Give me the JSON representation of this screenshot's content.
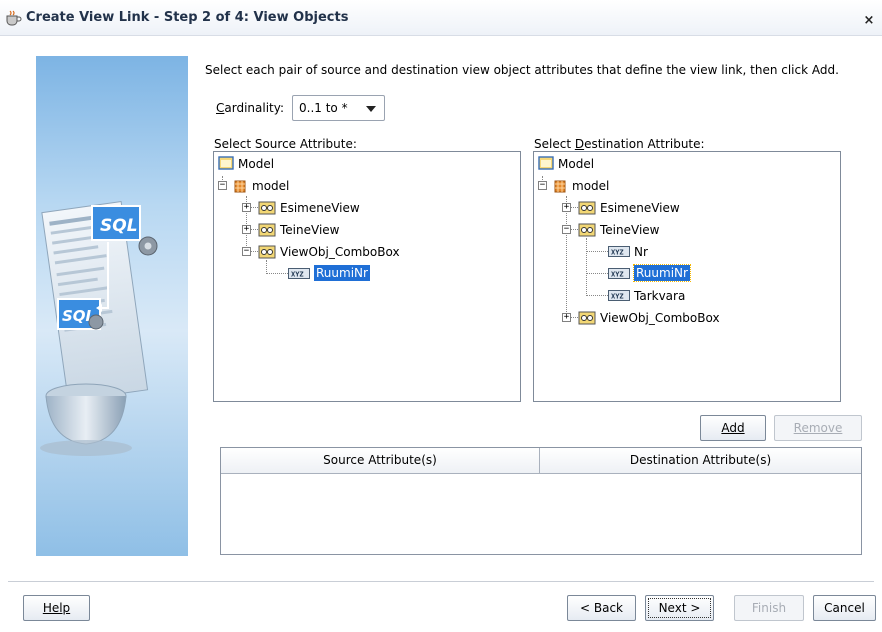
{
  "window": {
    "title": "Create View Link - Step 2 of 4: View Objects",
    "close_label": "×"
  },
  "instruction": "Select each pair of source and destination view object attributes that define the view link, then click Add.",
  "cardinality": {
    "label_pre": "",
    "label_accel": "C",
    "label_post": "ardinality:",
    "value": "0..1 to *"
  },
  "source": {
    "label_pre": "Select Source Attribute:",
    "tree": {
      "root": "Model",
      "package": "model",
      "items": [
        "EsimeneView",
        "TeineView",
        "ViewObj_ComboBox"
      ],
      "child": "RuumiNr"
    }
  },
  "destination": {
    "label_pre": "Select ",
    "label_accel": "D",
    "label_post": "estination Attribute:",
    "tree": {
      "root": "Model",
      "package": "model",
      "items": [
        "EsimeneView",
        "TeineView",
        "ViewObj_ComboBox"
      ],
      "children": [
        "Nr",
        "RuumiNr",
        "Tarkvara"
      ]
    }
  },
  "buttons": {
    "add": "Add",
    "remove": "Remove",
    "help": "Help",
    "back": "< Back",
    "next": "Next >",
    "finish": "Finish",
    "cancel": "Cancel"
  },
  "table": {
    "columns": [
      "Source Attribute(s)",
      "Destination Attribute(s)"
    ]
  },
  "colors": {
    "selection": "#1f6fd6",
    "panel_blue": "#7db4e4"
  },
  "illustration_text": "SQL"
}
